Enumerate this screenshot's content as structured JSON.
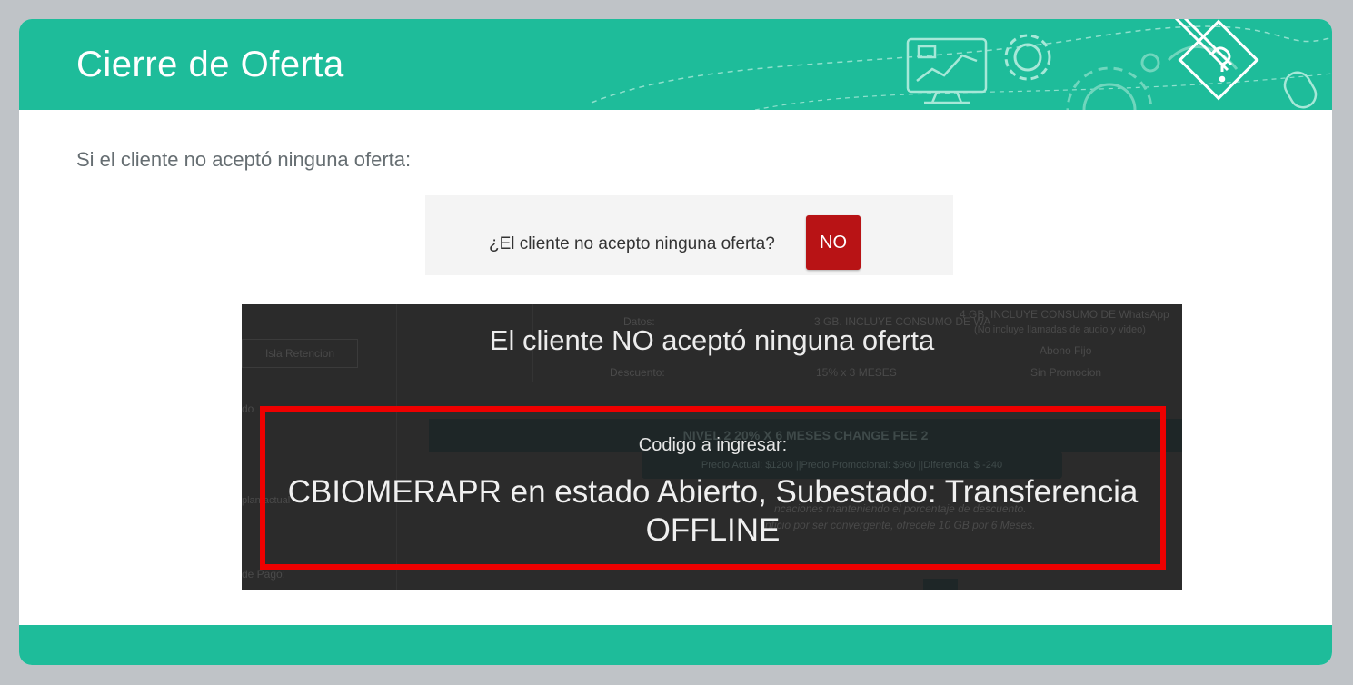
{
  "slide": {
    "title": "Cierre de Oferta",
    "intro": "Si el cliente no aceptó ninguna oferta:"
  },
  "question": {
    "text": "¿El cliente no acepto ninguna oferta?",
    "button_label": "NO"
  },
  "modal": {
    "title": "El cliente NO aceptó ninguna oferta",
    "code_label": "Codigo a ingresar:",
    "code_value": "CBIOMERAPR en estado Abierto, Subestado: Transferencia OFFLINE"
  },
  "background_app": {
    "tab_label": "Isla Retencion",
    "rows": [
      {
        "label": "Datos:",
        "col1": "3 GB. INCLUYE CONSUMO DE WA",
        "col2": "4 GB. INCLUYE CONSUMO DE WhatsApp"
      },
      {
        "label": "",
        "col1": "",
        "col2": "(No incluye llamadas de audio y video)"
      },
      {
        "label": "",
        "col1": "",
        "col2": "Abono Fijo"
      },
      {
        "label": "Descuento:",
        "col1": "15% x 3 MESES",
        "col2": "Sin Promocion"
      }
    ],
    "level_bar": "NIVEL 2 20% X 6 MESES CHANGE FEE 2",
    "price_pill": "Precio Actual: $1200 ||Precio Promocional: $960 ||Diferencia: $ -240",
    "side_labels": [
      "do",
      "plan actual",
      "de Pago:"
    ],
    "note_1": "ncaciones manteniendo el porcentaje de descuento.",
    "note_2": "nficio por ser convergente, ofrecele 10 GB por 6 Meses."
  },
  "colors": {
    "teal": "#1ebc9a",
    "no_button": "#b81315",
    "modal_bg": "#2b2b2b",
    "highlight_border": "#ee0000"
  },
  "icons": [
    "computer-chart-icon",
    "gear-icon",
    "pencil-question-icon",
    "mouse-icon"
  ]
}
